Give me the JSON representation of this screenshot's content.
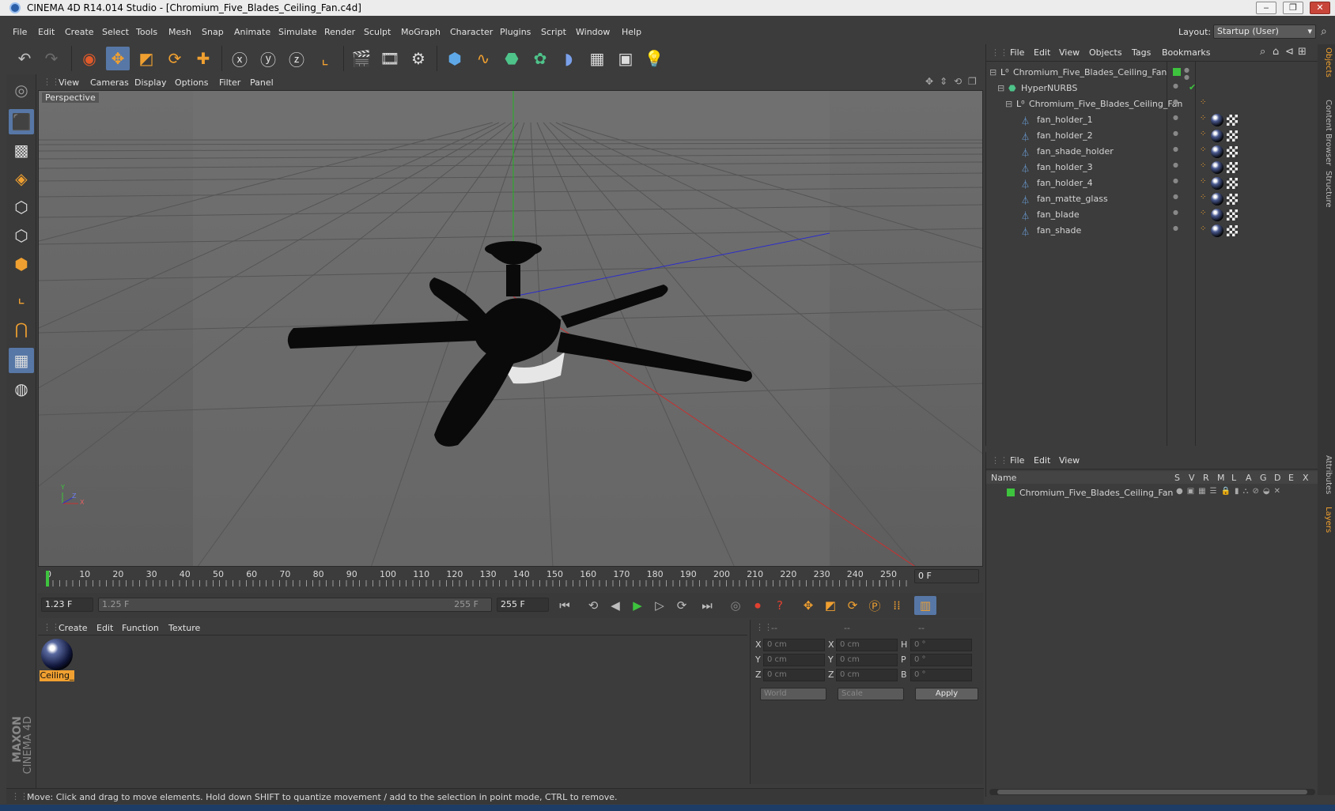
{
  "window": {
    "title": "CINEMA 4D R14.014 Studio - [Chromium_Five_Blades_Ceiling_Fan.c4d]",
    "min_icon": "minimize-icon",
    "max_icon": "restore-icon",
    "close_icon": "close-icon"
  },
  "menubar": {
    "items": [
      "File",
      "Edit",
      "Create",
      "Select",
      "Tools",
      "Mesh",
      "Snap",
      "Animate",
      "Simulate",
      "Render",
      "Sculpt",
      "MoGraph",
      "Character",
      "Plugins",
      "Script",
      "Window",
      "Help"
    ],
    "layout_label": "Layout:",
    "layout_value": "Startup (User)"
  },
  "viewport": {
    "menu": [
      "View",
      "Cameras",
      "Display",
      "Options",
      "Filter",
      "Panel"
    ],
    "label": "Perspective",
    "axis_x": "X",
    "axis_y": "Y",
    "axis_z": "Z"
  },
  "timeline": {
    "ticks": [
      "0",
      "10",
      "20",
      "30",
      "40",
      "50",
      "60",
      "70",
      "80",
      "90",
      "100",
      "110",
      "120",
      "130",
      "140",
      "150",
      "160",
      "170",
      "180",
      "190",
      "200",
      "210",
      "220",
      "230",
      "240",
      "250"
    ],
    "current_frame": "0 F",
    "start_field": "1.23 F",
    "range_start": "1.25 F",
    "range_end": "255 F",
    "end_field": "255 F",
    "playhead_fraction": 0.0
  },
  "materials": {
    "menu": [
      "Create",
      "Edit",
      "Function",
      "Texture"
    ],
    "items": [
      {
        "label": "Ceiling_"
      }
    ]
  },
  "coordinates": {
    "headers": [
      "--",
      "--",
      "--"
    ],
    "rows": [
      {
        "a": "X",
        "av": "0 cm",
        "b": "X",
        "bv": "0 cm",
        "c": "H",
        "cv": "0 °"
      },
      {
        "a": "Y",
        "av": "0 cm",
        "b": "Y",
        "bv": "0 cm",
        "c": "P",
        "cv": "0 °"
      },
      {
        "a": "Z",
        "av": "0 cm",
        "b": "Z",
        "bv": "0 cm",
        "c": "B",
        "cv": "0 °"
      }
    ],
    "mode1": "World",
    "mode2": "Scale",
    "apply": "Apply"
  },
  "status": "Move: Click and drag to move elements. Hold down SHIFT to quantize movement / add to the selection in point mode, CTRL to remove.",
  "objects": {
    "menu": [
      "File",
      "Edit",
      "View",
      "Objects",
      "Tags",
      "Bookmarks"
    ],
    "tree": [
      {
        "name": "Chromium_Five_Blades_Ceiling_Fan",
        "kind": "null"
      },
      {
        "name": "HyperNURBS",
        "kind": "nurbs"
      },
      {
        "name": "Chromium_Five_Blades_Ceiling_Fan",
        "kind": "null"
      },
      {
        "name": "fan_holder_1",
        "kind": "poly"
      },
      {
        "name": "fan_holder_2",
        "kind": "poly"
      },
      {
        "name": "fan_shade_holder",
        "kind": "poly"
      },
      {
        "name": "fan_holder_3",
        "kind": "poly"
      },
      {
        "name": "fan_holder_4",
        "kind": "poly"
      },
      {
        "name": "fan_matte_glass",
        "kind": "poly"
      },
      {
        "name": "fan_blade",
        "kind": "poly"
      },
      {
        "name": "fan_shade",
        "kind": "poly"
      }
    ]
  },
  "layers": {
    "menu": [
      "File",
      "Edit",
      "View"
    ],
    "columns": [
      "Name",
      "S",
      "V",
      "R",
      "M",
      "L",
      "A",
      "G",
      "D",
      "E",
      "X"
    ],
    "rows": [
      {
        "name": "Chromium_Five_Blades_Ceiling_Fan",
        "color": "#3ec33e"
      }
    ]
  },
  "side_tabs": [
    "Objects",
    "Content Browser",
    "Structure",
    "Attributes",
    "Layers"
  ],
  "branding": {
    "line1": "MAXON",
    "line2": "CINEMA 4D"
  },
  "colors": {
    "accent": "#5777a6",
    "orange": "#f0a030",
    "layer_green": "#3ec33e"
  }
}
